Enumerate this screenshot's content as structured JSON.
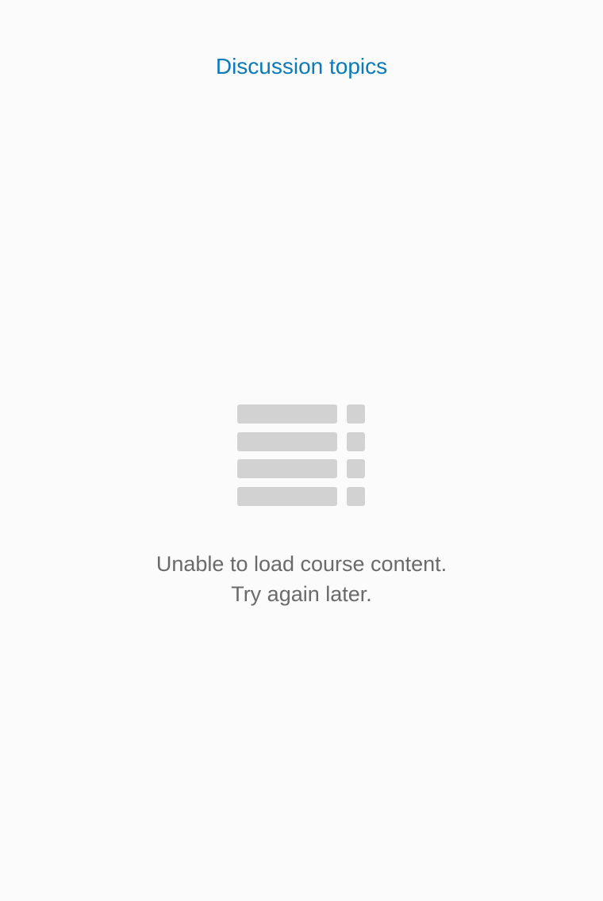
{
  "header": {
    "title": "Discussion topics",
    "color": "#0a7ab8"
  },
  "empty_state": {
    "icon": "list-placeholder-icon",
    "icon_color": "#d3d2d3",
    "line1": "Unable to load course content.",
    "line2": "Try again later.",
    "text_color": "#6a6a6a"
  }
}
